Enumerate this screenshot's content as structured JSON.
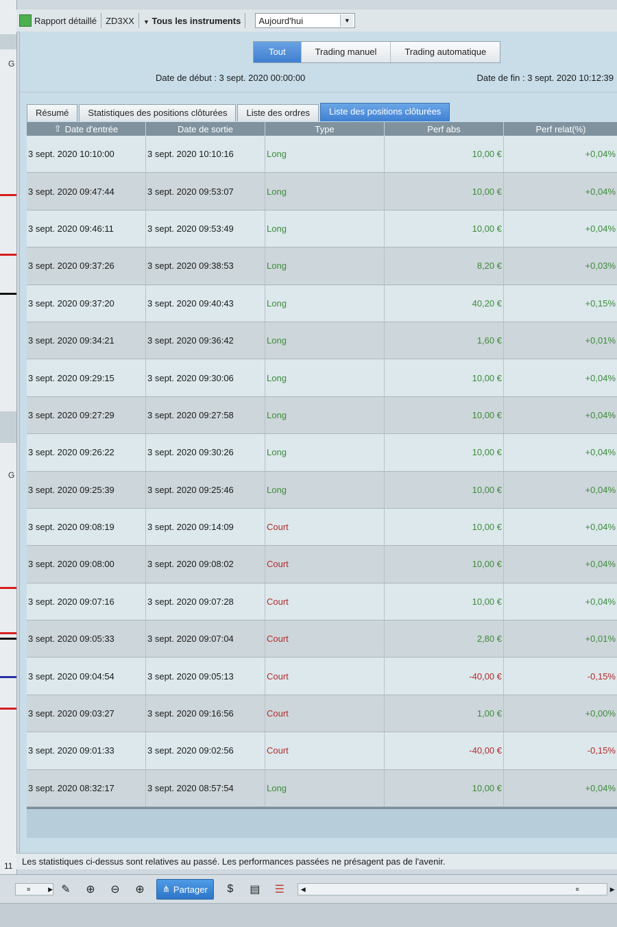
{
  "toolbar": {
    "report_label": "Rapport détaillé",
    "account": "ZD3XX",
    "instruments_label": "Tous les instruments",
    "period_value": "Aujourd'hui"
  },
  "mode_tabs": [
    "Tout",
    "Trading manuel",
    "Trading automatique"
  ],
  "dates": {
    "start": "Date de début : 3 sept. 2020 00:00:00",
    "end": "Date de fin : 3 sept. 2020 10:12:39"
  },
  "tabs": [
    "Résumé",
    "Statistiques des positions clôturées",
    "Liste des ordres",
    "Liste des positions clôturées"
  ],
  "table": {
    "headers": [
      "Date d'entrée",
      "Date de sortie",
      "Type",
      "Perf abs",
      "Perf relat(%)"
    ],
    "rows": [
      {
        "entry": "3 sept. 2020 10:10:00",
        "exit": "3 sept. 2020 10:10:16",
        "type": "Long",
        "perf_abs": "10,00 €",
        "perf_rel": "+0,04%"
      },
      {
        "entry": "3 sept. 2020 09:47:44",
        "exit": "3 sept. 2020 09:53:07",
        "type": "Long",
        "perf_abs": "10,00 €",
        "perf_rel": "+0,04%"
      },
      {
        "entry": "3 sept. 2020 09:46:11",
        "exit": "3 sept. 2020 09:53:49",
        "type": "Long",
        "perf_abs": "10,00 €",
        "perf_rel": "+0,04%"
      },
      {
        "entry": "3 sept. 2020 09:37:26",
        "exit": "3 sept. 2020 09:38:53",
        "type": "Long",
        "perf_abs": "8,20 €",
        "perf_rel": "+0,03%"
      },
      {
        "entry": "3 sept. 2020 09:37:20",
        "exit": "3 sept. 2020 09:40:43",
        "type": "Long",
        "perf_abs": "40,20 €",
        "perf_rel": "+0,15%"
      },
      {
        "entry": "3 sept. 2020 09:34:21",
        "exit": "3 sept. 2020 09:36:42",
        "type": "Long",
        "perf_abs": "1,60 €",
        "perf_rel": "+0,01%"
      },
      {
        "entry": "3 sept. 2020 09:29:15",
        "exit": "3 sept. 2020 09:30:06",
        "type": "Long",
        "perf_abs": "10,00 €",
        "perf_rel": "+0,04%"
      },
      {
        "entry": "3 sept. 2020 09:27:29",
        "exit": "3 sept. 2020 09:27:58",
        "type": "Long",
        "perf_abs": "10,00 €",
        "perf_rel": "+0,04%"
      },
      {
        "entry": "3 sept. 2020 09:26:22",
        "exit": "3 sept. 2020 09:30:26",
        "type": "Long",
        "perf_abs": "10,00 €",
        "perf_rel": "+0,04%"
      },
      {
        "entry": "3 sept. 2020 09:25:39",
        "exit": "3 sept. 2020 09:25:46",
        "type": "Long",
        "perf_abs": "10,00 €",
        "perf_rel": "+0,04%"
      },
      {
        "entry": "3 sept. 2020 09:08:19",
        "exit": "3 sept. 2020 09:14:09",
        "type": "Court",
        "perf_abs": "10,00 €",
        "perf_rel": "+0,04%"
      },
      {
        "entry": "3 sept. 2020 09:08:00",
        "exit": "3 sept. 2020 09:08:02",
        "type": "Court",
        "perf_abs": "10,00 €",
        "perf_rel": "+0,04%"
      },
      {
        "entry": "3 sept. 2020 09:07:16",
        "exit": "3 sept. 2020 09:07:28",
        "type": "Court",
        "perf_abs": "10,00 €",
        "perf_rel": "+0,04%"
      },
      {
        "entry": "3 sept. 2020 09:05:33",
        "exit": "3 sept. 2020 09:07:04",
        "type": "Court",
        "perf_abs": "2,80 €",
        "perf_rel": "+0,01%"
      },
      {
        "entry": "3 sept. 2020 09:04:54",
        "exit": "3 sept. 2020 09:05:13",
        "type": "Court",
        "perf_abs": "-40,00 €",
        "perf_rel": "-0,15%"
      },
      {
        "entry": "3 sept. 2020 09:03:27",
        "exit": "3 sept. 2020 09:16:56",
        "type": "Court",
        "perf_abs": "1,00 €",
        "perf_rel": "+0,00%"
      },
      {
        "entry": "3 sept. 2020 09:01:33",
        "exit": "3 sept. 2020 09:02:56",
        "type": "Court",
        "perf_abs": "-40,00 €",
        "perf_rel": "-0,15%"
      },
      {
        "entry": "3 sept. 2020 08:32:17",
        "exit": "3 sept. 2020 08:57:54",
        "type": "Long",
        "perf_abs": "10,00 €",
        "perf_rel": "+0,04%"
      }
    ]
  },
  "disclaimer": "Les statistiques ci-dessus sont relatives au passé. Les performances passées ne présagent pas de l'avenir.",
  "bottom_toolbar": {
    "share_label": "Partager"
  },
  "strip": {
    "label_g": "G",
    "number": "11"
  },
  "colors": {
    "long": "#3d8a3b",
    "short": "#b42a2a",
    "accent": "#3f7fd0"
  }
}
